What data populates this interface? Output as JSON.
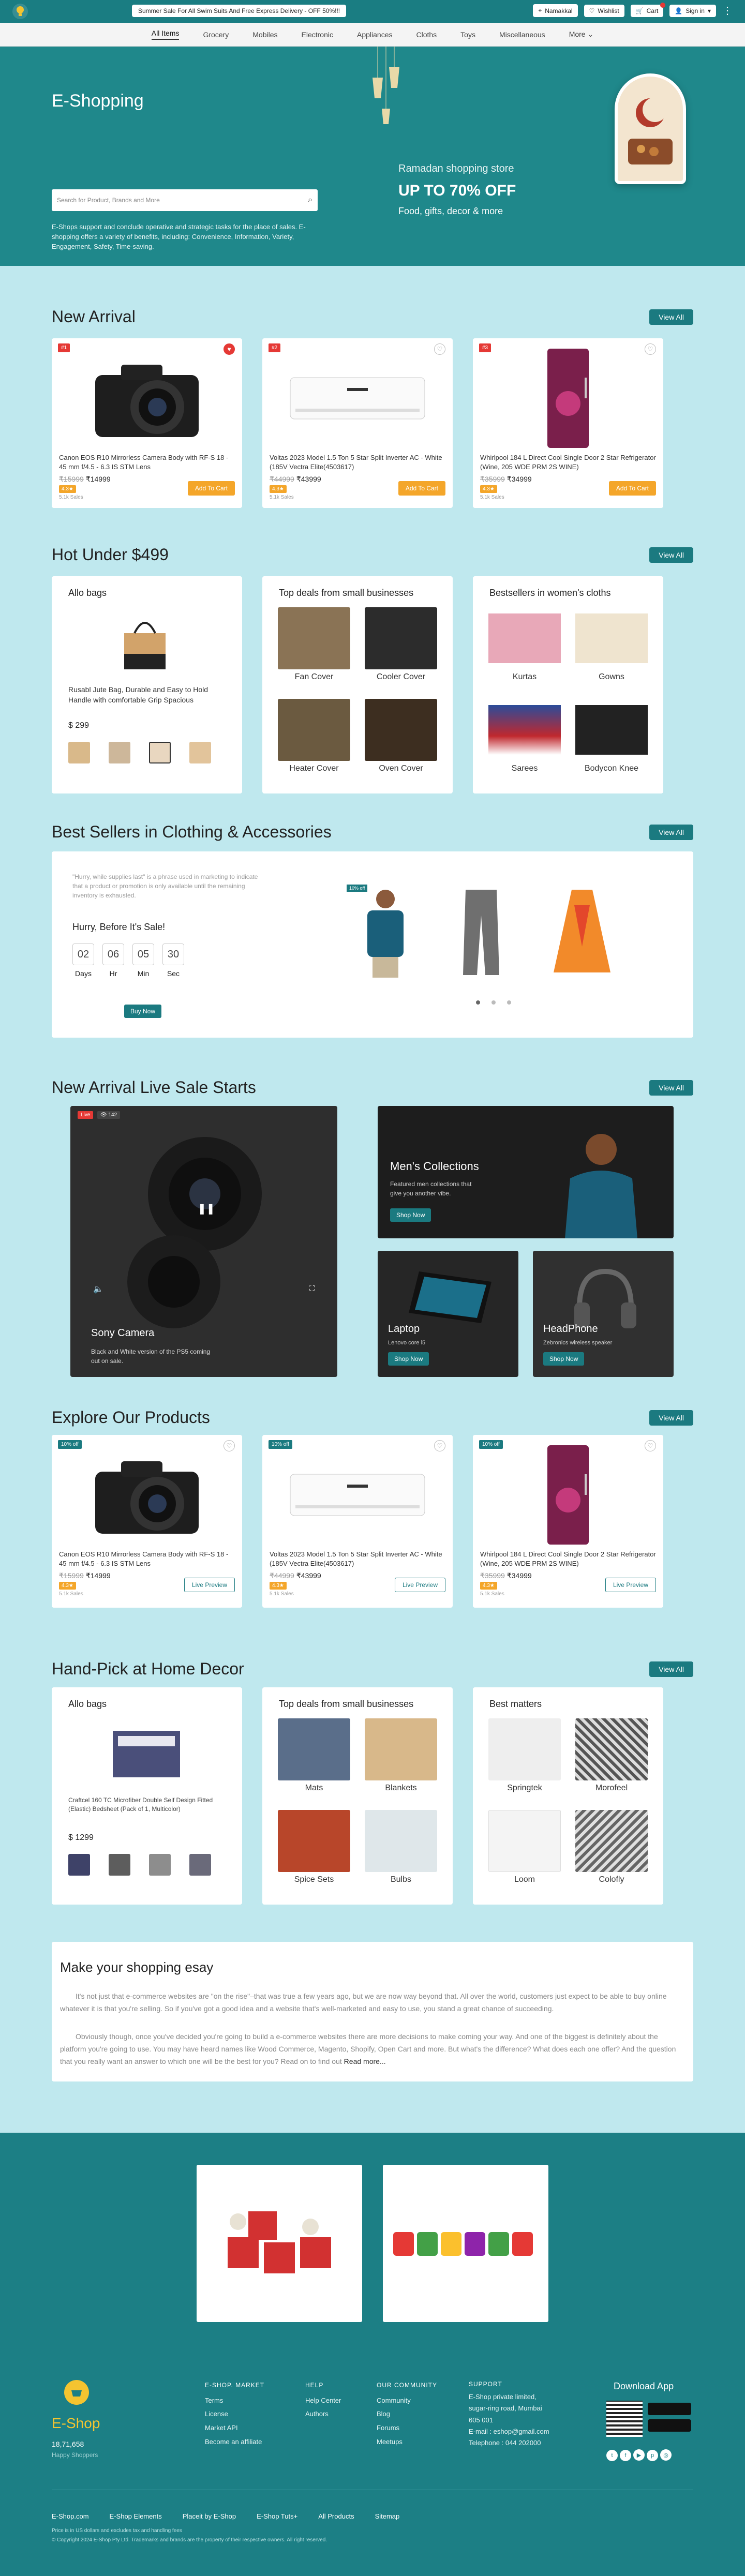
{
  "colors": {
    "teal": "#1b7a80",
    "orange": "#f4a62a",
    "red": "#e53935",
    "light_bg": "#bfe8ee"
  },
  "topbar": {
    "promo": "Summer Sale For All Swim Suits And Free Express Delivery - OFF 50%!!!",
    "location": "Namakkal",
    "wishlist": "Wishlist",
    "cart": "Cart",
    "signin": "Sign in",
    "menu_icon": "vertical-dots-icon"
  },
  "nav": [
    "All Items",
    "Grocery",
    "Mobiles",
    "Electronic",
    "Appliances",
    "Cloths",
    "Toys",
    "Miscellaneous",
    "More"
  ],
  "hero": {
    "title": "E-Shopping",
    "search_placeholder": "Search for Product, Brands and More",
    "description": "E-Shops support and conclude operative and strategic tasks for the place of sales. E-shopping offers a variety of benefits, including: Convenience, Information, Variety, Engagement, Safety, Time-saving.",
    "promo_small": "Ramadan shopping store",
    "promo_big": "UP TO 70% OFF",
    "promo_sub": "Food, gifts, decor & more"
  },
  "view_all": "View All",
  "new_arrival": {
    "title": "New Arrival",
    "products": [
      {
        "tag": "#1",
        "name": "Canon EOS R10 Mirrorless Camera Body with RF-S 18 - 45 mm f/4.5 - 6.3 IS STM Lens",
        "old": "₹15999",
        "price": "₹14999",
        "rating": "4.3★",
        "sales": "5.1k Sales",
        "btn": "Add To Cart"
      },
      {
        "tag": "#2",
        "name": "Voltas 2023 Model 1.5 Ton 5 Star Split Inverter AC - White (185V Vectra Elite(4503617)",
        "old": "₹44999",
        "price": "₹43999",
        "rating": "4.3★",
        "sales": "5.1k Sales",
        "btn": "Add To Cart"
      },
      {
        "tag": "#3",
        "name": "Whirlpool 184 L Direct Cool Single Door 2 Star Refrigerator (Wine, 205 WDE PRM 2S WINE)",
        "old": "₹35999",
        "price": "₹34999",
        "rating": "4.3★",
        "sales": "5.1k Sales",
        "btn": "Add To Cart"
      }
    ]
  },
  "hot": {
    "title": "Hot Under $499",
    "allo": {
      "title": "Allo bags",
      "product": "Rusabl Jute Bag, Durable and Easy to Hold Handle with comfortable Grip Spacious",
      "price": "$ 299"
    },
    "small": {
      "title": "Top deals from small businesses",
      "items": [
        "Fan Cover",
        "Cooler Cover",
        "Heater Cover",
        "Oven Cover"
      ]
    },
    "women": {
      "title": "Bestsellers in women's cloths",
      "items": [
        "Kurtas",
        "Gowns",
        "Sarees",
        "Bodycon Knee"
      ]
    }
  },
  "best": {
    "title": "Best Sellers in Clothing & Accessories",
    "quote": "\"Hurry, while supplies last\" is a phrase used in marketing to indicate that a product or promotion is only available until the remaining inventory is exhausted.",
    "hurry": "Hurry, Before It's Sale!",
    "count": [
      {
        "v": "02",
        "l": "Days"
      },
      {
        "v": "06",
        "l": "Hr"
      },
      {
        "v": "05",
        "l": "Min"
      },
      {
        "v": "30",
        "l": "Sec"
      }
    ],
    "buy": "Buy Now",
    "badge": "10% off"
  },
  "live": {
    "title": "New Arrival Live Sale Starts",
    "live_badge": "Live",
    "views": "142",
    "camera_title": "Sony Camera",
    "camera_desc": "Black and White version of the PS5 coming out on sale.",
    "mens_title": "Men's Collections",
    "mens_desc": "Featured men collections that give you another vibe.",
    "shop": "Shop Now",
    "laptop": "Laptop",
    "laptop_desc": "Lenovo core i5",
    "head": "HeadPhone",
    "head_desc": "Zebronics wireless speaker"
  },
  "explore": {
    "title": "Explore Our Products",
    "badge": "10% off",
    "btn": "Live Preview"
  },
  "home": {
    "title": "Hand-Pick at Home Decor",
    "allo": {
      "title": "Allo bags",
      "product": "Craftcel 160 TC Microfiber Double Self Design Fitted (Elastic) Bedsheet (Pack of 1, Multicolor)",
      "price": "$ 1299"
    },
    "small": {
      "title": "Top deals from small businesses",
      "items": [
        "Mats",
        "Blankets",
        "Spice Sets",
        "Bulbs"
      ]
    },
    "matts": {
      "title": "Best matters",
      "items": [
        "Springtek",
        "Morofeel",
        "Loom",
        "Colofly"
      ]
    }
  },
  "essay": {
    "title": "Make your shopping esay",
    "p1": "It's not just that e-commerce websites are \"on the rise\"–that was true a few years ago, but we are now way beyond that. All over the world, customers just expect to be able to buy online whatever it is that you're selling. So if you've got a good idea and a website that's well-marketed and easy to use, you stand a great chance of succeeding.",
    "p2": "Obviously though, once you've decided you're going to build a e-commerce websites there are more decisions to make coming your way. And one of the biggest is definitely about the platform you're going to use. You may have heard names like Wood Commerce, Magento, Shopify, Open Cart and more. But what's the difference? What does each one offer? And the question that you really want an answer to which one will be the best for you? Read on to find out",
    "readmore": "Read more..."
  },
  "footer": {
    "brand": "E-Shop",
    "stats": "18,71,658",
    "stats_sub": "Happy Shoppers",
    "cols": [
      {
        "title": "E-SHOP. MARKET",
        "links": [
          "Terms",
          "License",
          "Market API",
          "Become an affiliate"
        ]
      },
      {
        "title": "HELP",
        "links": [
          "Help Center",
          "Authors"
        ]
      },
      {
        "title": "OUR COMMUNITY",
        "links": [
          "Community",
          "Blog",
          "Forums",
          "Meetups"
        ]
      },
      {
        "title": "SUPPORT",
        "links": [
          "E-Shop private limited,",
          "sugar-ring road, Mumbai",
          "605 001",
          "E-mail : eshop@gmail.com",
          "Telephone : 044 202000"
        ]
      }
    ],
    "download": "Download App",
    "bottom_links": [
      "E-Shop.com",
      "E-Shop Elements",
      "Placeit by E-Shop",
      "E-Shop Tuts+",
      "All Products",
      "Sitemap"
    ],
    "note1": "Price is in US dollars and excludes tax and handling fees",
    "note2": "© Copyright 2024 E-Shop Pty Ltd. Trademarks and brands are the property of their respective owners. All right reserved."
  }
}
